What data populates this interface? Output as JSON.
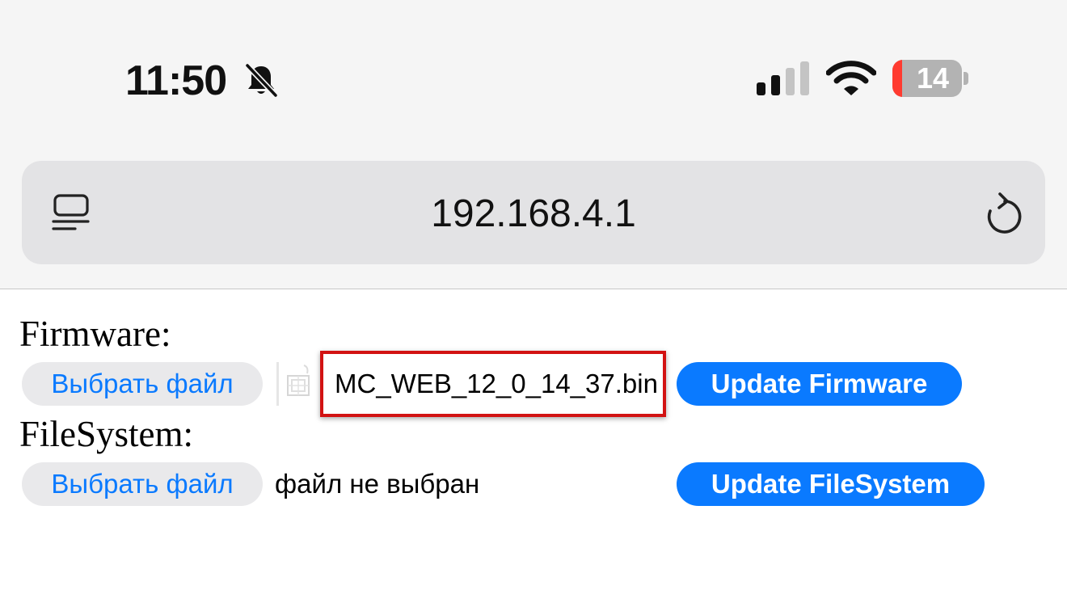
{
  "status_bar": {
    "time": "11:50",
    "battery_percent": "14",
    "battery_level": 0.14,
    "icons": [
      "bell-slash-icon",
      "cellular-signal-icon",
      "wifi-icon",
      "battery-icon"
    ]
  },
  "browser": {
    "url": "192.168.4.1",
    "icons": [
      "reader-mode-icon",
      "reload-icon"
    ]
  },
  "firmware": {
    "label": "Firmware:",
    "choose_button": "Выбрать файл",
    "file_name": "MC_WEB_12_0_14_37.bin",
    "update_button": "Update Firmware"
  },
  "filesystem": {
    "label": "FileSystem:",
    "choose_button": "Выбрать файл",
    "file_status": "файл не выбран",
    "update_button": "Update FileSystem"
  },
  "colors": {
    "accent": "#0a7aff",
    "highlight_border": "#d21212",
    "battery_low": "#ff3b30"
  }
}
